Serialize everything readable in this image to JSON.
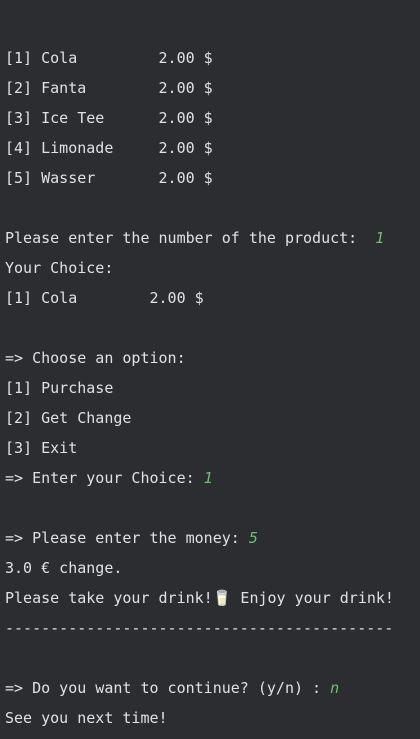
{
  "products": [
    {
      "label": "[1] Cola         2.00 $"
    },
    {
      "label": "[2] Fanta        2.00 $"
    },
    {
      "label": "[3] Ice Tee      2.00 $"
    },
    {
      "label": "[4] Limonade     2.00 $"
    },
    {
      "label": "[5] Wasser       2.00 $"
    }
  ],
  "product_prompt": "Please enter the number of the product:  ",
  "product_input": "1",
  "choice_heading": "Your Choice:",
  "choice_line": "[1] Cola        2.00 $",
  "options_heading": "=> Choose an option:",
  "options": [
    {
      "label": "[1] Purchase"
    },
    {
      "label": "[2] Get Change"
    },
    {
      "label": "[3] Exit"
    }
  ],
  "option_prompt": "=> Enter your Choice: ",
  "option_input": "1",
  "money_prompt": "=> Please enter the money: ",
  "money_input": "5",
  "change_line": "3.0 € change.",
  "take_drink_before": "Please take your drink!",
  "drink_emoji": "🥛",
  "take_drink_after": " Enjoy your drink!",
  "divider": "-------------------------------------------",
  "continue_prompt": "=> Do you want to continue? (y/n) : ",
  "continue_input": "n",
  "goodbye": "See you next time!"
}
